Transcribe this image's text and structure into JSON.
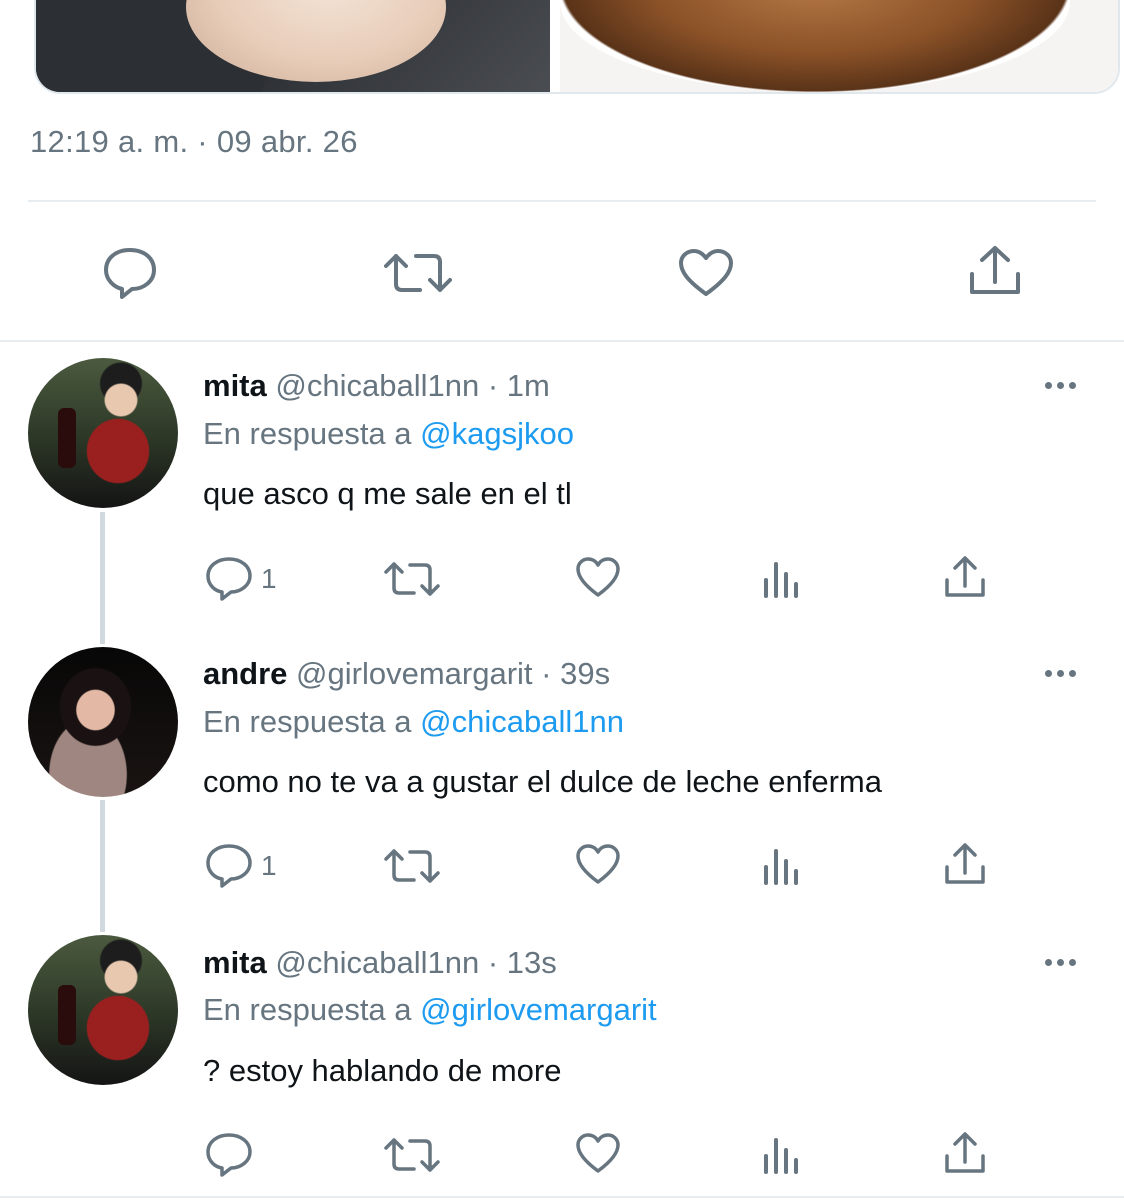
{
  "tweet": {
    "timestamp": "12:19 a. m. · 09 abr. 26",
    "icons": [
      "reply-icon",
      "retweet-icon",
      "like-icon",
      "share-icon"
    ]
  },
  "replies": [
    {
      "name": "mita",
      "handle": "@chicaball1nn",
      "sep": "·",
      "time": "1m",
      "reply_prefix": "En respuesta a",
      "reply_to": "@kagsjkoo",
      "text": "que asco q me sale en el tl",
      "reply_count": "1"
    },
    {
      "name": "andre",
      "handle": "@girlovemargarit",
      "sep": "·",
      "time": "39s",
      "reply_prefix": "En respuesta a",
      "reply_to": "@chicaball1nn",
      "text": "como no te va a gustar el dulce de leche enferma",
      "reply_count": "1"
    },
    {
      "name": "mita",
      "handle": "@chicaball1nn",
      "sep": "·",
      "time": "13s",
      "reply_prefix": "En respuesta a",
      "reply_to": "@girlovemargarit",
      "text": "? estoy hablando de more",
      "reply_count": ""
    }
  ],
  "colors": {
    "accent": "#1d9bf0",
    "secondary_text": "#66757f",
    "divider": "#e6ecf0"
  }
}
